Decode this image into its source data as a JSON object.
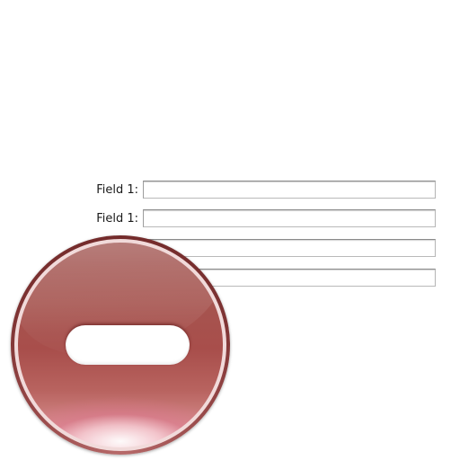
{
  "form": {
    "rows": [
      {
        "label": "Field 1:",
        "value": ""
      },
      {
        "label": "Field 1:",
        "value": ""
      },
      {
        "value": ""
      },
      {
        "value": ""
      }
    ]
  },
  "badge": {
    "icon": "minus-icon",
    "color": "#a84e4b"
  }
}
